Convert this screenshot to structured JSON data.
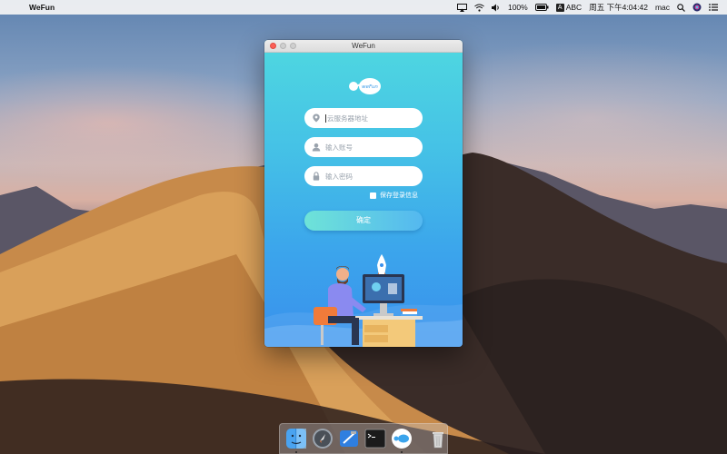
{
  "menubar": {
    "app_name": "WeFun",
    "battery_percent": "100%",
    "input_method": "ABC",
    "clock": "周五 下午4:04:42",
    "user": "mac"
  },
  "window": {
    "title": "WeFun",
    "logo_text": "weFun",
    "server_placeholder": "云服务器地址",
    "account_placeholder": "输入账号",
    "password_placeholder": "输入密码",
    "remember_label": "保存登录信息",
    "confirm_label": "确定"
  },
  "dock": {
    "items": [
      "Finder",
      "Launchpad",
      "Xcode",
      "Terminal",
      "WeFun",
      "Trash"
    ]
  },
  "colors": {
    "accent": "#3ba4ec",
    "window_top": "#4fd8e0",
    "button_start": "#6ee3d8",
    "button_end": "#54b8f0"
  }
}
